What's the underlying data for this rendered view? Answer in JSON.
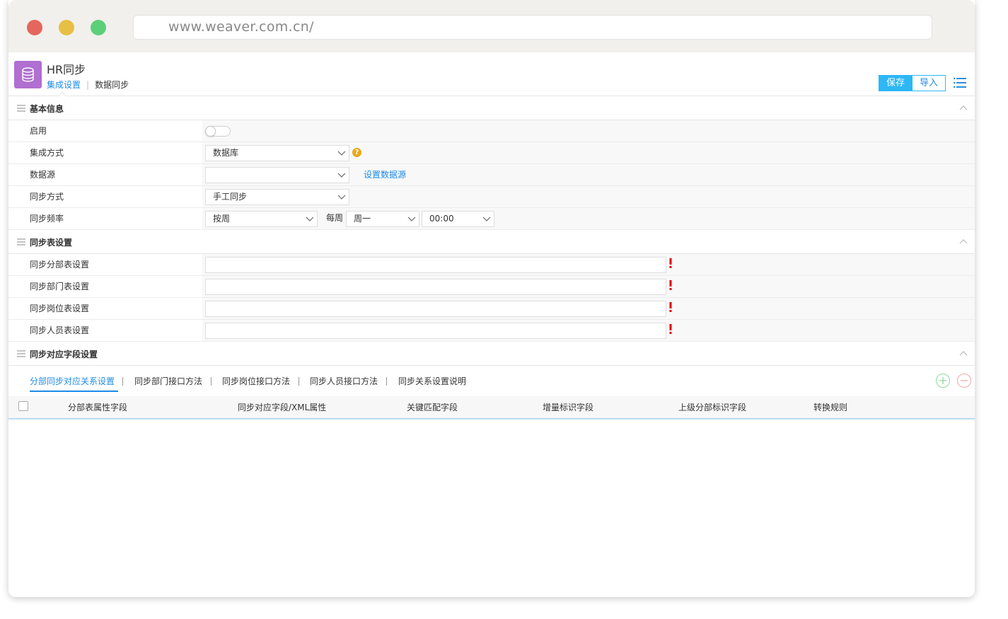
{
  "browser": {
    "url": "www.weaver.com.cn/"
  },
  "header": {
    "title": "HR同步",
    "tabs": [
      {
        "label": "集成设置"
      },
      {
        "label": "数据同步"
      }
    ],
    "save_label": "保存",
    "import_label": "导入"
  },
  "basic": {
    "title": "基本信息",
    "enable_label": "启用",
    "method_label": "集成方式",
    "method_value": "数据库",
    "datasource_label": "数据源",
    "datasource_value": "",
    "datasource_link": "设置数据源",
    "sync_mode_label": "同步方式",
    "sync_mode_value": "手工同步",
    "freq_label": "同步频率",
    "freq_value": "按周",
    "weekly_label": "每周",
    "weekday_value": "周一",
    "time_value": "00:00"
  },
  "tables": {
    "title": "同步表设置",
    "rows": [
      {
        "label": "同步分部表设置",
        "value": ""
      },
      {
        "label": "同步部门表设置",
        "value": ""
      },
      {
        "label": "同步岗位表设置",
        "value": ""
      },
      {
        "label": "同步人员表设置",
        "value": ""
      }
    ]
  },
  "fields": {
    "title": "同步对应字段设置",
    "tabs": [
      {
        "label": "分部同步对应关系设置"
      },
      {
        "label": "同步部门接口方法"
      },
      {
        "label": "同步岗位接口方法"
      },
      {
        "label": "同步人员接口方法"
      },
      {
        "label": "同步关系设置说明"
      }
    ],
    "columns": [
      "分部表属性字段",
      "同步对应字段/XML属性",
      "关键匹配字段",
      "增量标识字段",
      "上级分部标识字段",
      "转换规则"
    ]
  },
  "colors": {
    "accent": "#1d8be8",
    "primary_button": "#2db7f5",
    "app_icon": "#b06fd1",
    "required": "#e00000"
  }
}
